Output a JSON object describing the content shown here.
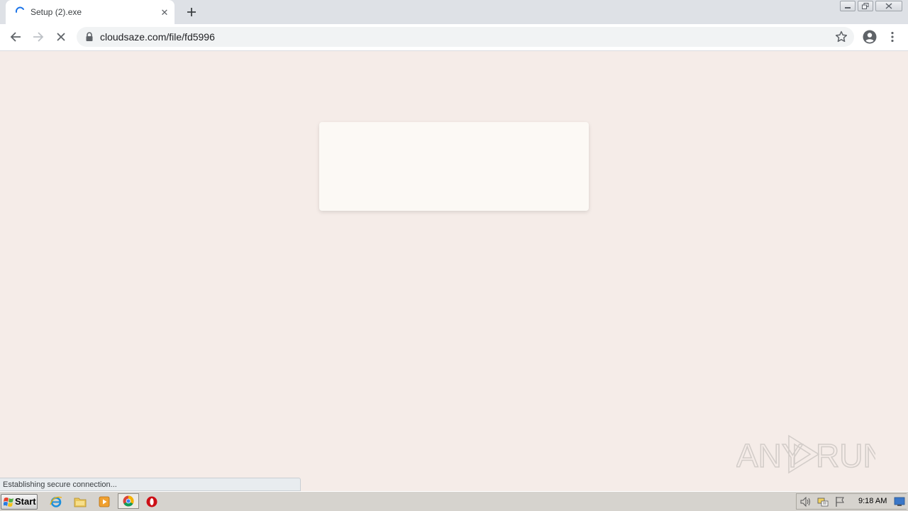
{
  "browser": {
    "tab": {
      "title": "Setup (2).exe",
      "close_glyph": "✕"
    },
    "address_bar": {
      "url": "cloudsaze.com/file/fd5996"
    }
  },
  "page": {
    "status_text": "Establishing secure connection...",
    "watermark": {
      "left": "ANY",
      "right": "RUN"
    }
  },
  "taskbar": {
    "start_label": "Start",
    "clock": "9:18 AM"
  },
  "colors": {
    "page_background": "#f5ece8",
    "card_background": "#fcf9f5",
    "tab_strip": "#dee1e6",
    "spinner": "#1a73e8"
  },
  "icons": [
    "loading-spinner-icon",
    "close-icon",
    "plus-icon",
    "back-arrow-icon",
    "forward-arrow-icon",
    "stop-icon",
    "lock-icon",
    "star-icon",
    "account-icon",
    "menu-dots-icon",
    "windows-flag-icon",
    "internet-explorer-icon",
    "folder-icon",
    "media-player-icon",
    "chrome-icon",
    "opera-icon",
    "speaker-icon",
    "network-icon",
    "action-center-flag-icon",
    "show-desktop-icon"
  ]
}
